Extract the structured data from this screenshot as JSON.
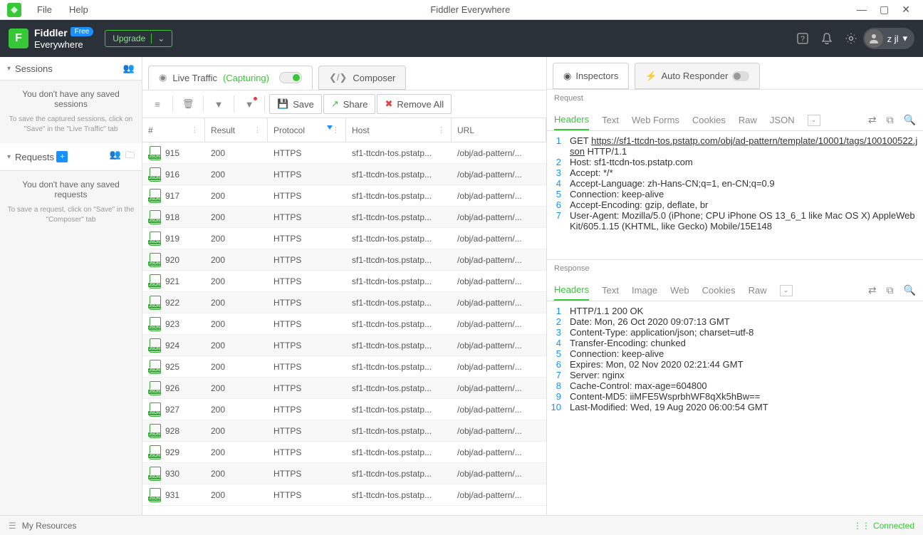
{
  "titlebar": {
    "file": "File",
    "help": "Help",
    "title": "Fiddler Everywhere"
  },
  "header": {
    "logo_line1": "Fiddler",
    "logo_line2": "Everywhere",
    "free_badge": "Free",
    "upgrade": "Upgrade",
    "user_name": "z jl"
  },
  "sidebar": {
    "sessions": {
      "title": "Sessions",
      "empty_msg": "You don't have any saved sessions",
      "empty_hint": "To save the captured sessions, click on \"Save\" in the \"Live Traffic\" tab"
    },
    "requests": {
      "title": "Requests",
      "empty_msg": "You don't have any saved requests",
      "empty_hint": "To save a request, click on \"Save\" in the \"Composer\" tab"
    }
  },
  "center_tabs": {
    "live": "Live Traffic",
    "capturing": "(Capturing)",
    "composer": "Composer"
  },
  "toolbar": {
    "save": "Save",
    "share": "Share",
    "remove_all": "Remove All"
  },
  "grid": {
    "columns": {
      "num": "#",
      "result": "Result",
      "protocol": "Protocol",
      "host": "Host",
      "url": "URL"
    },
    "rows": [
      {
        "num": "915",
        "result": "200",
        "protocol": "HTTPS",
        "host": "sf1-ttcdn-tos.pstatp...",
        "url": "/obj/ad-pattern/..."
      },
      {
        "num": "916",
        "result": "200",
        "protocol": "HTTPS",
        "host": "sf1-ttcdn-tos.pstatp...",
        "url": "/obj/ad-pattern/..."
      },
      {
        "num": "917",
        "result": "200",
        "protocol": "HTTPS",
        "host": "sf1-ttcdn-tos.pstatp...",
        "url": "/obj/ad-pattern/..."
      },
      {
        "num": "918",
        "result": "200",
        "protocol": "HTTPS",
        "host": "sf1-ttcdn-tos.pstatp...",
        "url": "/obj/ad-pattern/..."
      },
      {
        "num": "919",
        "result": "200",
        "protocol": "HTTPS",
        "host": "sf1-ttcdn-tos.pstatp...",
        "url": "/obj/ad-pattern/..."
      },
      {
        "num": "920",
        "result": "200",
        "protocol": "HTTPS",
        "host": "sf1-ttcdn-tos.pstatp...",
        "url": "/obj/ad-pattern/..."
      },
      {
        "num": "921",
        "result": "200",
        "protocol": "HTTPS",
        "host": "sf1-ttcdn-tos.pstatp...",
        "url": "/obj/ad-pattern/..."
      },
      {
        "num": "922",
        "result": "200",
        "protocol": "HTTPS",
        "host": "sf1-ttcdn-tos.pstatp...",
        "url": "/obj/ad-pattern/..."
      },
      {
        "num": "923",
        "result": "200",
        "protocol": "HTTPS",
        "host": "sf1-ttcdn-tos.pstatp...",
        "url": "/obj/ad-pattern/..."
      },
      {
        "num": "924",
        "result": "200",
        "protocol": "HTTPS",
        "host": "sf1-ttcdn-tos.pstatp...",
        "url": "/obj/ad-pattern/..."
      },
      {
        "num": "925",
        "result": "200",
        "protocol": "HTTPS",
        "host": "sf1-ttcdn-tos.pstatp...",
        "url": "/obj/ad-pattern/..."
      },
      {
        "num": "926",
        "result": "200",
        "protocol": "HTTPS",
        "host": "sf1-ttcdn-tos.pstatp...",
        "url": "/obj/ad-pattern/..."
      },
      {
        "num": "927",
        "result": "200",
        "protocol": "HTTPS",
        "host": "sf1-ttcdn-tos.pstatp...",
        "url": "/obj/ad-pattern/..."
      },
      {
        "num": "928",
        "result": "200",
        "protocol": "HTTPS",
        "host": "sf1-ttcdn-tos.pstatp...",
        "url": "/obj/ad-pattern/..."
      },
      {
        "num": "929",
        "result": "200",
        "protocol": "HTTPS",
        "host": "sf1-ttcdn-tos.pstatp...",
        "url": "/obj/ad-pattern/..."
      },
      {
        "num": "930",
        "result": "200",
        "protocol": "HTTPS",
        "host": "sf1-ttcdn-tos.pstatp...",
        "url": "/obj/ad-pattern/..."
      },
      {
        "num": "931",
        "result": "200",
        "protocol": "HTTPS",
        "host": "sf1-ttcdn-tos.pstatp...",
        "url": "/obj/ad-pattern/..."
      }
    ]
  },
  "inspector": {
    "tabs": {
      "inspectors": "Inspectors",
      "auto_responder": "Auto Responder"
    },
    "request_label": "Request",
    "response_label": "Response",
    "req_tabs": [
      "Headers",
      "Text",
      "Web Forms",
      "Cookies",
      "Raw",
      "JSON"
    ],
    "resp_tabs": [
      "Headers",
      "Text",
      "Image",
      "Web",
      "Cookies",
      "Raw"
    ],
    "req_lines": [
      "GET https://sf1-ttcdn-tos.pstatp.com/obj/ad-pattern/template/10001/tags/100100522.json HTTP/1.1",
      "Host: sf1-ttcdn-tos.pstatp.com",
      "Accept: */*",
      "Accept-Language: zh-Hans-CN;q=1, en-CN;q=0.9",
      "Connection: keep-alive",
      "Accept-Encoding: gzip, deflate, br",
      "User-Agent: Mozilla/5.0 (iPhone; CPU iPhone OS 13_6_1 like Mac OS X) AppleWebKit/605.1.15 (KHTML, like Gecko) Mobile/15E148"
    ],
    "resp_lines": [
      "HTTP/1.1 200 OK",
      "Date: Mon, 26 Oct 2020 09:07:13 GMT",
      "Content-Type: application/json; charset=utf-8",
      "Transfer-Encoding: chunked",
      "Connection: keep-alive",
      "Expires: Mon, 02 Nov 2020 02:21:44 GMT",
      "Server: nginx",
      "Cache-Control: max-age=604800",
      "Content-MD5: iiMFE5WsprbhWF8qXk5hBw==",
      "Last-Modified: Wed, 19 Aug 2020 06:00:54 GMT"
    ]
  },
  "footer": {
    "my_resources": "My Resources",
    "connected": "Connected"
  }
}
